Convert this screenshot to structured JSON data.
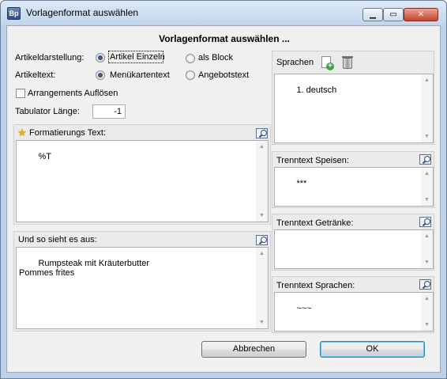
{
  "window": {
    "title": "Vorlagenformat auswählen",
    "app_icon": "Bp",
    "close_glyph": "✕"
  },
  "dialog": {
    "heading": "Vorlagenformat auswählen ..."
  },
  "artikeldarstellung": {
    "label": "Artikeldarstellung:",
    "options": [
      "Artikel Einzeln",
      "als Block"
    ],
    "selected": "Artikel Einzeln"
  },
  "artikeltext": {
    "label": "Artikeltext:",
    "options": [
      "Menükartentext",
      "Angebotstext"
    ],
    "selected": "Menükartentext"
  },
  "arrangements": {
    "label": "Arrangements Auflösen",
    "checked": false
  },
  "tabulator": {
    "label": "Tabulator Länge:",
    "value": "-1"
  },
  "formatierung": {
    "title": "Formatierungs Text:",
    "content": "%T"
  },
  "vorschau": {
    "title": "Und so sieht es aus:",
    "content": "Rumpsteak mit Kräuterbutter\nPommes frites"
  },
  "sprachen": {
    "title": "Sprachen",
    "items": [
      "1. deutsch"
    ]
  },
  "trenntext_speisen": {
    "title": "Trenntext Speisen:",
    "content": "***"
  },
  "trenntext_getraenke": {
    "title": "Trenntext Getränke:",
    "content": ""
  },
  "trenntext_sprachen": {
    "title": "Trenntext Sprachen:",
    "content": "~~~"
  },
  "buttons": {
    "cancel": "Abbrechen",
    "ok": "OK"
  },
  "icons": [
    "app-icon",
    "minimize-icon",
    "maximize-icon",
    "close-icon",
    "star-icon",
    "zoom-icon",
    "add-document-icon",
    "trash-icon"
  ]
}
